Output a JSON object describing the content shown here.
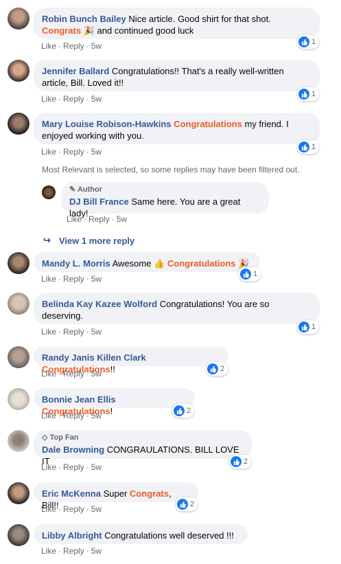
{
  "actions": {
    "like": "Like",
    "reply": "Reply",
    "dot": "·",
    "time": "5w"
  },
  "notice": "Most Relevant is selected, so some replies may have been filtered out.",
  "view_more": "View 1 more reply",
  "colors": {
    "name": "#385898",
    "highlight": "#f05a28",
    "bubble": "#f0f2f5",
    "like": "#1877f2"
  },
  "comments": [
    {
      "name": "Robin Bunch Bailey",
      "parts": [
        "Nice article. Good shirt for that shot. ",
        "Congrats",
        " and continued good luck"
      ],
      "reactions": "1"
    },
    {
      "name": "Jennifer Ballard",
      "parts": [
        "Congratulations!! That's a really well-written article, Bill. Loved it!!"
      ],
      "reactions": "1"
    },
    {
      "name": "Mary Louise Robison-Hawkins",
      "parts": [
        "Congratulations",
        " my friend. I enjoyed working with you."
      ],
      "reactions": "1"
    },
    {
      "name": "Mandy L. Morris",
      "parts": [
        "Awesome ",
        "Congratulations"
      ],
      "reactions": "1"
    },
    {
      "name": "Belinda Kay Kazee Wolford",
      "parts": [
        "Congratulations! You are so deserving."
      ],
      "reactions": "1"
    },
    {
      "name": "Randy Janis Killen Clark",
      "parts": [
        "Congratulations",
        "!!"
      ],
      "reactions": "2"
    },
    {
      "name": "Bonnie Jean Ellis",
      "parts": [
        "Congratulations",
        "!"
      ],
      "reactions": "2"
    },
    {
      "name": "Dale Browning",
      "badge": "Top Fan",
      "parts": [
        "CONGRAULATIONS. BILL LOVE IT"
      ],
      "reactions": "2"
    },
    {
      "name": "Eric McKenna",
      "parts": [
        "Super ",
        "Congrats",
        ", Bill!!"
      ],
      "reactions": "2"
    },
    {
      "name": "Libby Albright",
      "parts": [
        "Congratulations well deserved !!!"
      ]
    }
  ],
  "reply": {
    "badge": "Author",
    "name": "DJ Bill France",
    "text": "Same here. You are a great lady!"
  }
}
